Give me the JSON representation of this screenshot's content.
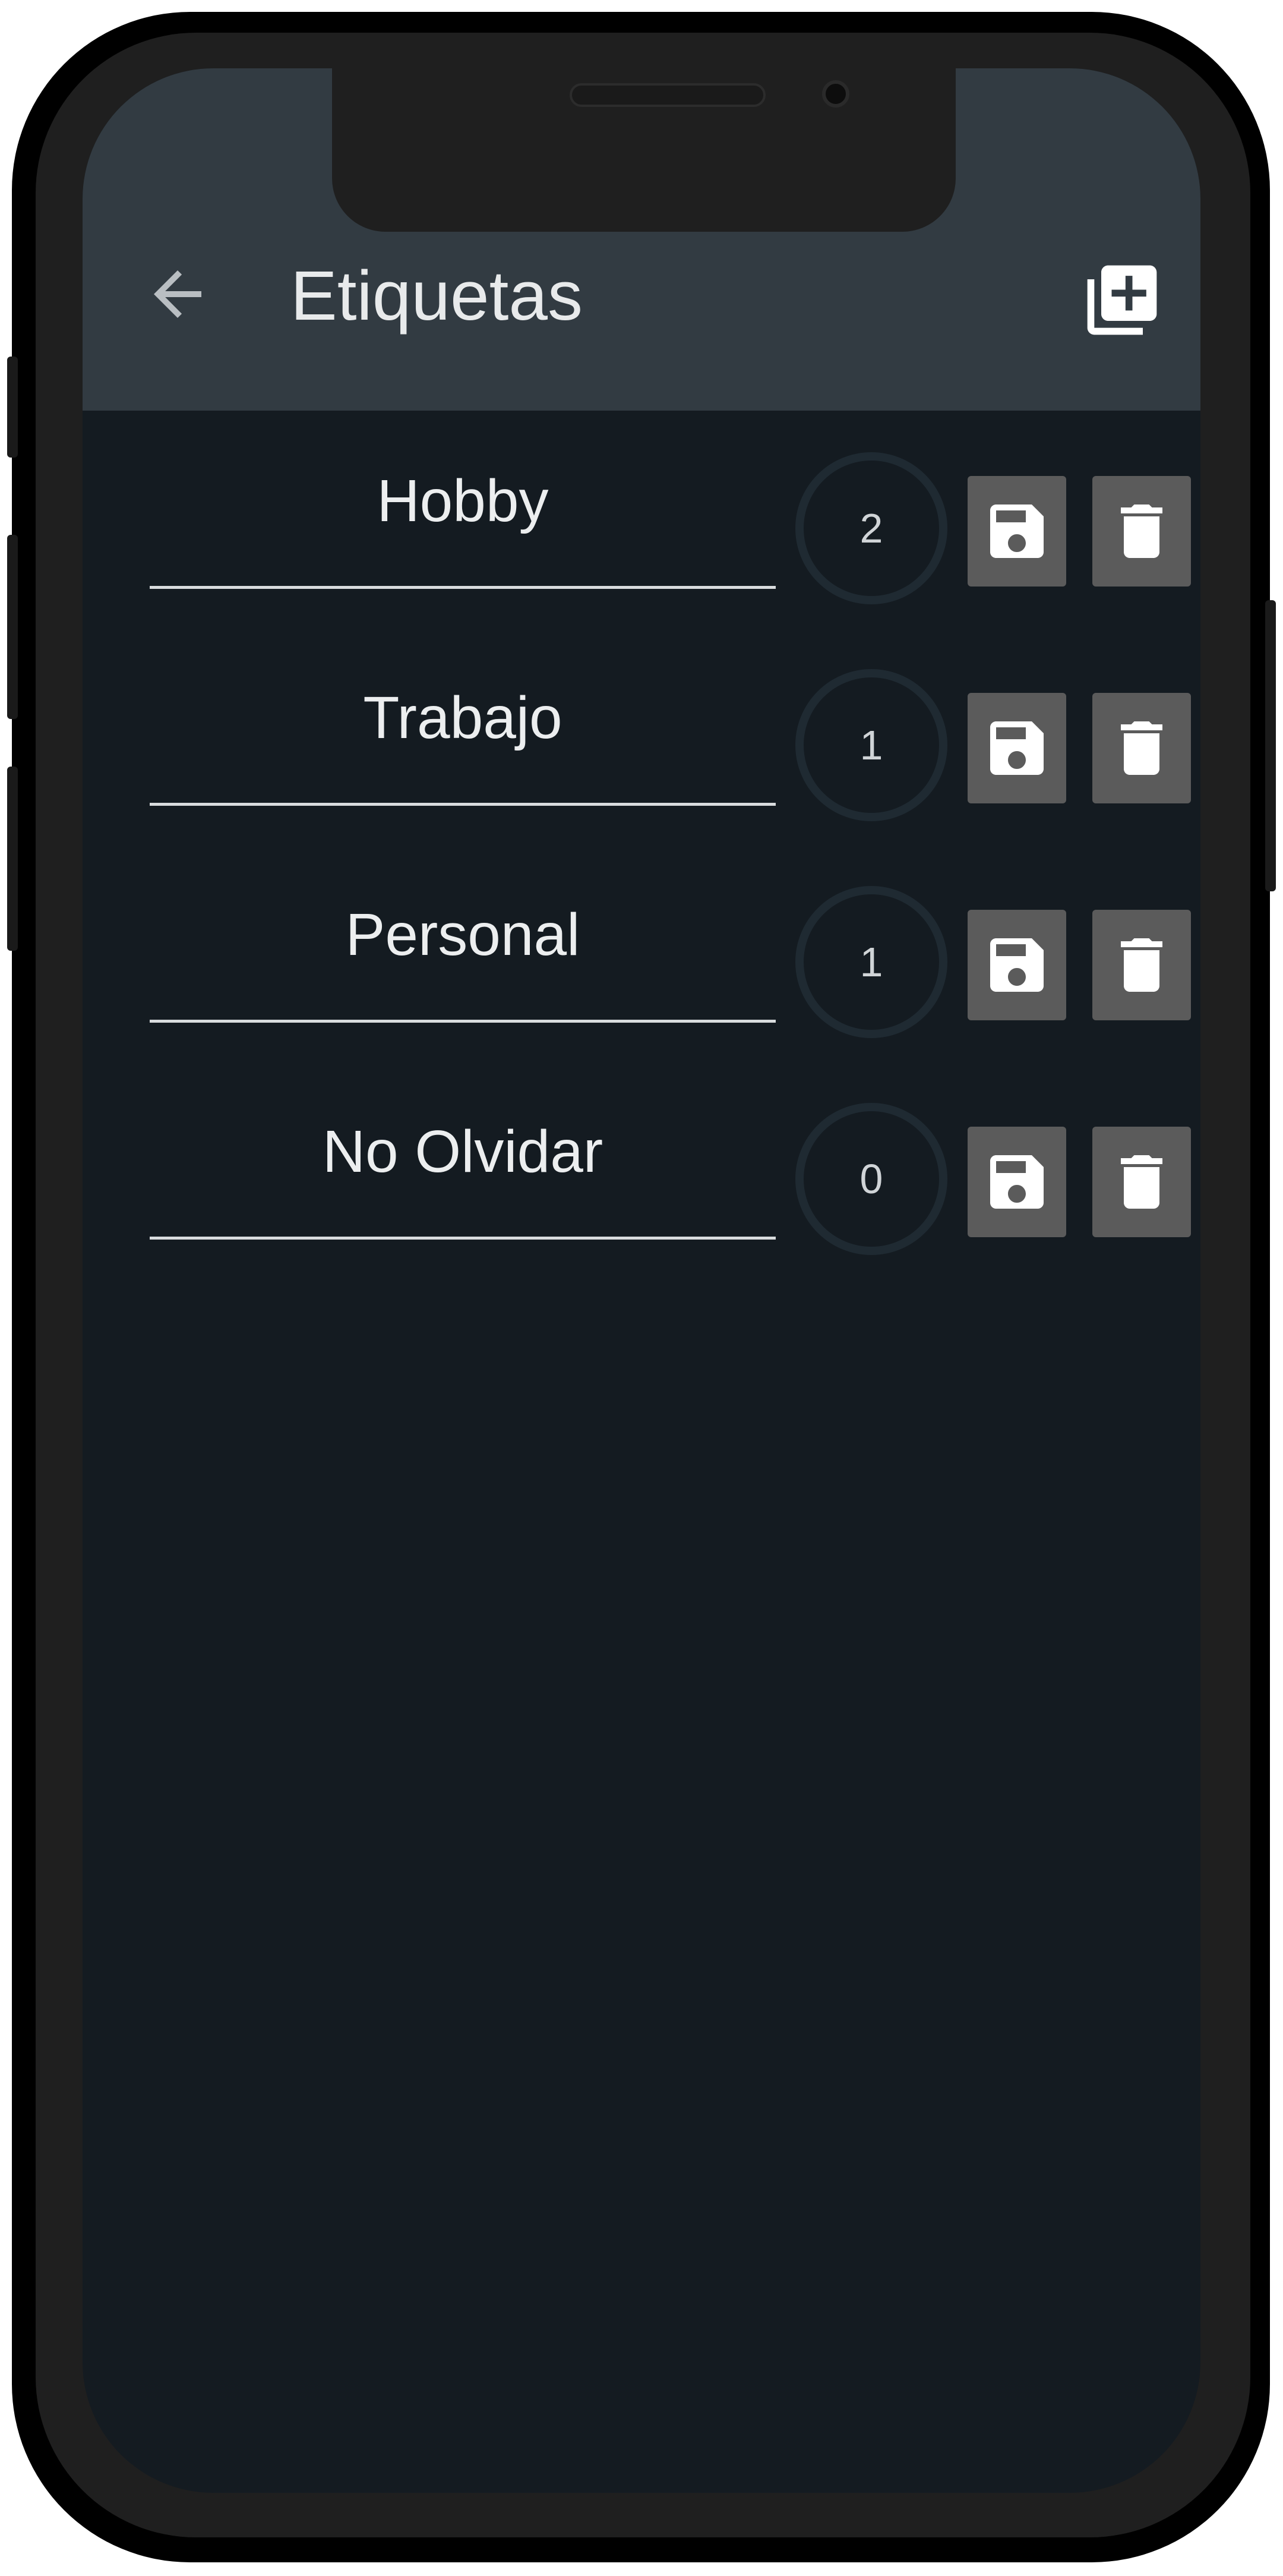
{
  "header": {
    "title": "Etiquetas",
    "back_icon": "arrow-back-icon",
    "add_icon": "library-add-icon"
  },
  "tags": [
    {
      "label": "Hobby",
      "count": "2"
    },
    {
      "label": "Trabajo",
      "count": "1"
    },
    {
      "label": "Personal",
      "count": "1"
    },
    {
      "label": "No Olvidar",
      "count": "0"
    }
  ],
  "row_icons": {
    "save": "save-icon",
    "delete": "delete-icon"
  },
  "colors": {
    "appbar": "#323b42",
    "background": "#141b21",
    "button": "#5b5b5b",
    "text": "#eceeef"
  }
}
